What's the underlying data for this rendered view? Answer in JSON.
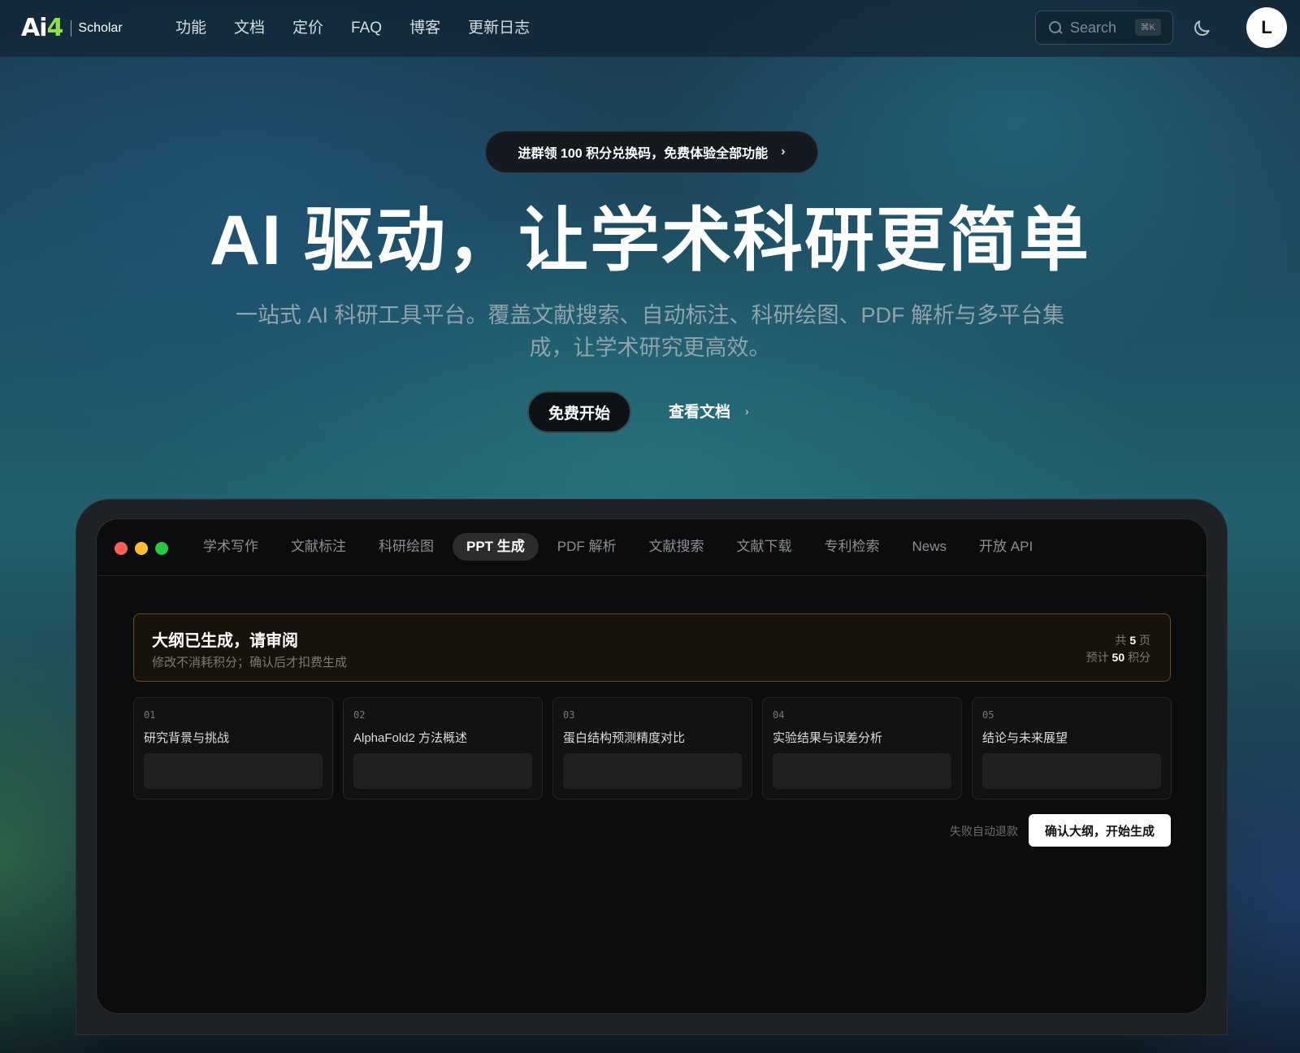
{
  "nav": {
    "logo_mark_ai": "Ai",
    "logo_mark_four": "4",
    "logo_text": "Scholar",
    "links": [
      "功能",
      "文档",
      "定价",
      "FAQ",
      "博客",
      "更新日志"
    ],
    "search_placeholder": "Search",
    "search_shortcut": "⌘K",
    "avatar_initial": "L"
  },
  "hero": {
    "promo": "进群领 100 积分兑换码，免费体验全部功能",
    "promo_chevron": "›",
    "title": "AI 驱动，让学术科研更简单",
    "subtitle_line1": "一站式 AI 科研工具平台。覆盖文献搜索、自动标注、科研绘图、PDF 解析与多平台集",
    "subtitle_line2": "成，让学术研究更高效。",
    "primary_button": "免费开始",
    "secondary_link": "查看文档",
    "secondary_chevron": "›"
  },
  "demo": {
    "window_dots": [
      "#ff5f57",
      "#febc2e",
      "#28c840"
    ],
    "tabs": [
      "学术写作",
      "文献标注",
      "科研绘图",
      "PPT 生成",
      "PDF 解析",
      "文献搜索",
      "文献下载",
      "专利检索",
      "News",
      "开放 API"
    ],
    "active_tab": "PPT 生成",
    "notice": {
      "title": "大纲已生成，请审阅",
      "subtitle": "修改不消耗积分；确认后才扣费生成",
      "pages_prefix": "共",
      "pages_value": "5",
      "pages_suffix": "页",
      "cost_prefix": "预计",
      "cost_value": "50",
      "cost_suffix": "积分"
    },
    "outline": [
      {
        "num": "01",
        "title": "研究背景与挑战"
      },
      {
        "num": "02",
        "title": "AlphaFold2 方法概述"
      },
      {
        "num": "03",
        "title": "蛋白结构预测精度对比"
      },
      {
        "num": "04",
        "title": "实验结果与误差分析"
      },
      {
        "num": "05",
        "title": "结论与未来展望"
      }
    ],
    "refund_note": "失败自动退款",
    "confirm_button": "确认大纲，开始生成"
  },
  "colors": {
    "logo_accent": "#8fe04a",
    "notice_border": "#6e4a14"
  }
}
